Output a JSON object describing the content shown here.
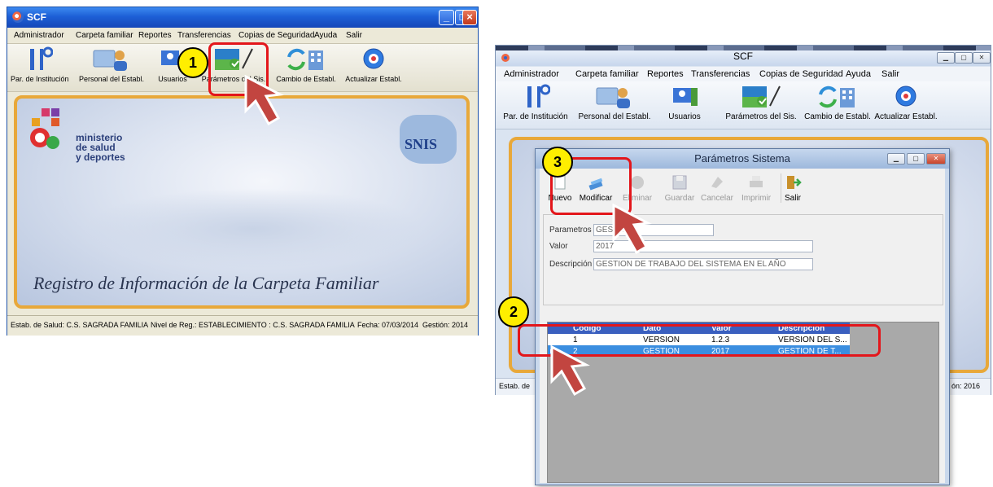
{
  "left_window": {
    "title": "SCF",
    "menu": [
      "Administrador",
      "Carpeta familiar",
      "Reportes",
      "Transferencias",
      "Copias de Seguridad",
      "Ayuda",
      "Salir"
    ],
    "toolbar": [
      "Par. de Institución",
      "Personal del Establ.",
      "Usuarios",
      "Parámetros del Sis.",
      "Cambio de Establ.",
      "Actualizar Establ."
    ],
    "banner": {
      "logo_lines": [
        "ministerio",
        "de salud",
        "y deportes"
      ],
      "snis": "SNIS",
      "caption": "Registro de Información de la Carpeta Familiar"
    },
    "status": {
      "estab": "Estab. de Salud: C.S. SAGRADA FAMILIA",
      "nivel": "Nivel de Reg.: ESTABLECIMIENTO : C.S. SAGRADA FAMILIA",
      "fecha": "Fecha: 07/03/2014",
      "gestion": "Gestión: 2014"
    }
  },
  "right_window": {
    "title": "SCF",
    "menu": [
      "Administrador",
      "Carpeta familiar",
      "Reportes",
      "Transferencias",
      "Copias de Seguridad",
      "Ayuda",
      "Salir"
    ],
    "toolbar": [
      "Par. de Institución",
      "Personal del Establ.",
      "Usuarios",
      "Parámetros del Sis.",
      "Cambio de Establ.",
      "Actualizar Establ."
    ],
    "status": {
      "estab": "Estab. de",
      "gestion": "ón: 2016"
    }
  },
  "dialog": {
    "title": "Parámetros Sistema",
    "toolbar": [
      {
        "label": "Nuevo",
        "enabled": true
      },
      {
        "label": "Modificar",
        "enabled": true
      },
      {
        "label": "Eliminar",
        "enabled": false
      },
      {
        "label": "Guardar",
        "enabled": false
      },
      {
        "label": "Cancelar",
        "enabled": false
      },
      {
        "label": "Imprimir",
        "enabled": false
      },
      {
        "label": "Salir",
        "enabled": true
      }
    ],
    "fields": {
      "parametros_label": "Parametros",
      "parametros_value": "GESTION",
      "valor_label": "Valor",
      "valor_value": "2017",
      "descripcion_label": "Descripción",
      "descripcion_value": "GESTION DE TRABAJO DEL SISTEMA EN EL AÑO"
    },
    "grid": {
      "columns": [
        "Código",
        "Dato",
        "Valor",
        "Descripción"
      ],
      "rows": [
        [
          "1",
          "VERSION",
          "1.2.3",
          "VERSION DEL S..."
        ],
        [
          "2",
          "GESTION",
          "2017",
          "GESTION DE T..."
        ]
      ]
    }
  },
  "annotations": {
    "step1": "1",
    "step2": "2",
    "step3": "3"
  },
  "colors": {
    "highlight": "#e3161b",
    "badge": "#ffee00",
    "selected_row": "#3b8ee0"
  }
}
